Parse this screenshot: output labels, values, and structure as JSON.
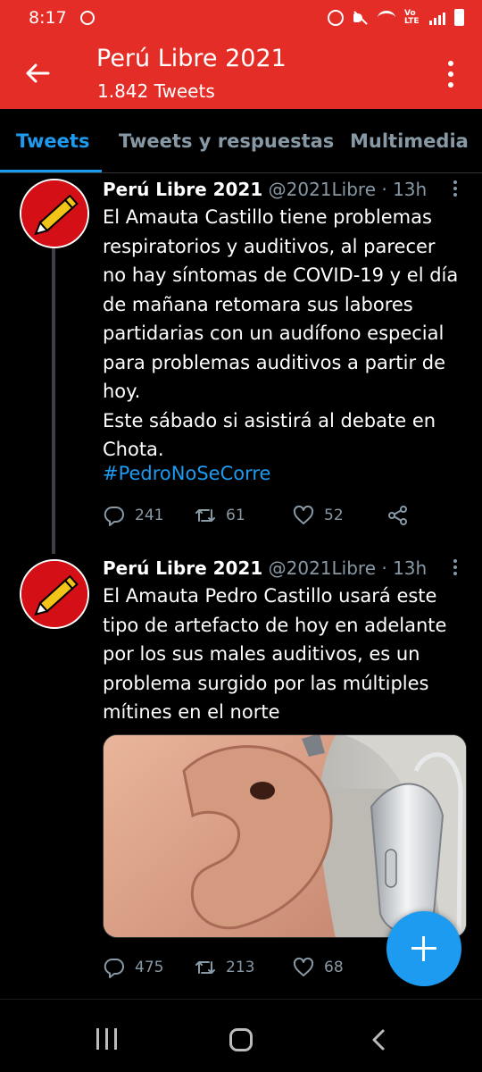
{
  "status_bar": {
    "time": "8:17",
    "lte_label": "Vo LTE",
    "icons": [
      "whatsapp-icon",
      "alarm-icon",
      "mute-icon",
      "wifi-icon",
      "signal-icon",
      "battery-icon"
    ]
  },
  "header": {
    "title": "Perú Libre 2021",
    "subtitle": "1.842 Tweets",
    "color": "#e52d27"
  },
  "tabs": [
    {
      "label": "Tweets",
      "active": true
    },
    {
      "label": "Tweets y respuestas",
      "active": false
    },
    {
      "label": "Multimedia",
      "active": false
    }
  ],
  "tweets": [
    {
      "name": "Perú Libre 2021",
      "handle": "@2021Libre",
      "time": "13h",
      "meta": "@2021Libre · 13h",
      "lines": [
        "El Amauta Castillo tiene problemas",
        "respiratorios y auditivos, al parecer",
        "no hay síntomas de COVID-19 y el día",
        "de mañana retomara sus labores",
        "partidarias con un audífono especial",
        "para problemas auditivos a partir de",
        "hoy.",
        "Este sábado si asistirá al debate en",
        "Chota."
      ],
      "hashtag": "#PedroNoSeCorre",
      "replies": "241",
      "retweets": "61",
      "likes": "52"
    },
    {
      "name": "Perú Libre 2021",
      "handle": "@2021Libre",
      "time": "13h",
      "meta": "@2021Libre · 13h",
      "lines": [
        "El Amauta Pedro Castillo usará este",
        "tipo de artefacto de hoy en adelante",
        "por los sus males auditivos, es un",
        "problema surgido por las múltiples",
        "mítines en el norte"
      ],
      "replies": "475",
      "retweets": "213",
      "likes": "68"
    }
  ],
  "colors": {
    "accent": "#1d9bf0",
    "muted": "#8899a6",
    "brand_red": "#e52d27"
  }
}
